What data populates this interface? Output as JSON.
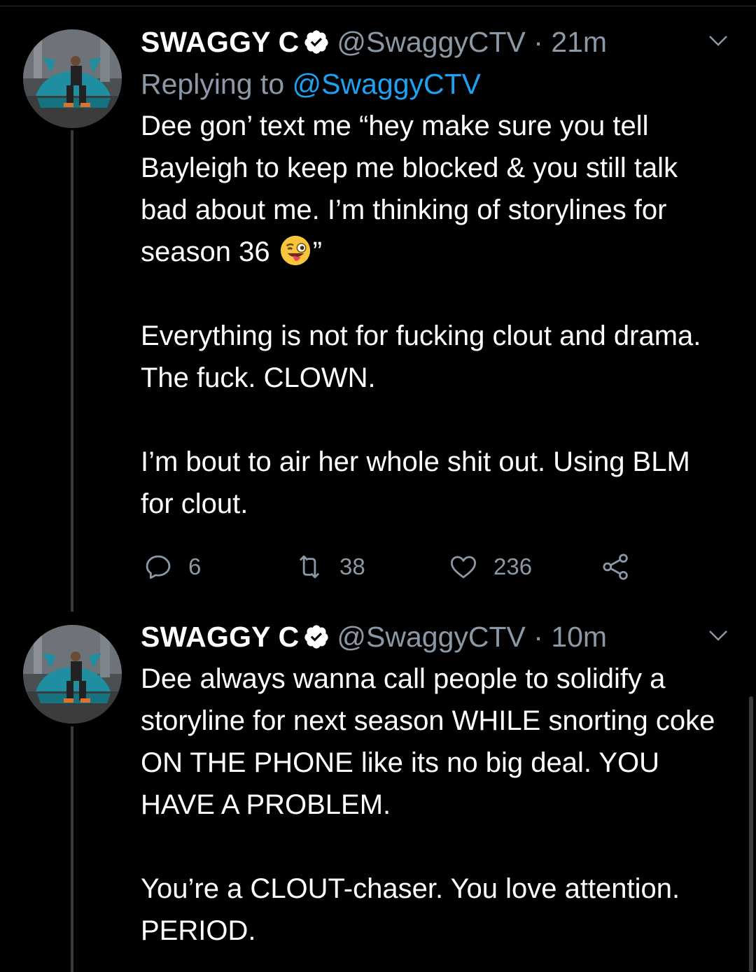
{
  "tweets": [
    {
      "name": "SWAGGY C",
      "handle": "@SwaggyCTV",
      "time": "· 21m",
      "replying_prefix": "Replying to ",
      "replying_to": "@SwaggyCTV",
      "paragraphs": [
        "Dee gon’ text me “hey make sure you tell Bayleigh to keep me blocked & you still talk bad about me. I’m thinking of storylines for season 36",
        "Everything is not for fucking clout and drama. The fuck. CLOWN.",
        "I’m bout to air her whole shit out. Using BLM for clout."
      ],
      "closing_quote": "”",
      "emoji": "winking-face-with-tongue-emoji",
      "actions": {
        "replies": "6",
        "retweets": "38",
        "likes": "236"
      }
    },
    {
      "name": "SWAGGY C",
      "handle": "@SwaggyCTV",
      "time": "· 10m",
      "paragraphs": [
        "Dee always wanna call people to solidify a storyline for next season WHILE snorting coke ON THE PHONE like its no big deal. YOU HAVE A PROBLEM.",
        "You’re a CLOUT-chaser. You love attention. PERIOD."
      ]
    }
  ],
  "icons": [
    "verified-badge-icon",
    "chevron-down-icon",
    "reply-icon",
    "retweet-icon",
    "like-icon",
    "share-icon"
  ],
  "colors": {
    "background": "#000000",
    "text": "#ffffff",
    "secondary": "#8b98a5",
    "link": "#1da1f2"
  }
}
